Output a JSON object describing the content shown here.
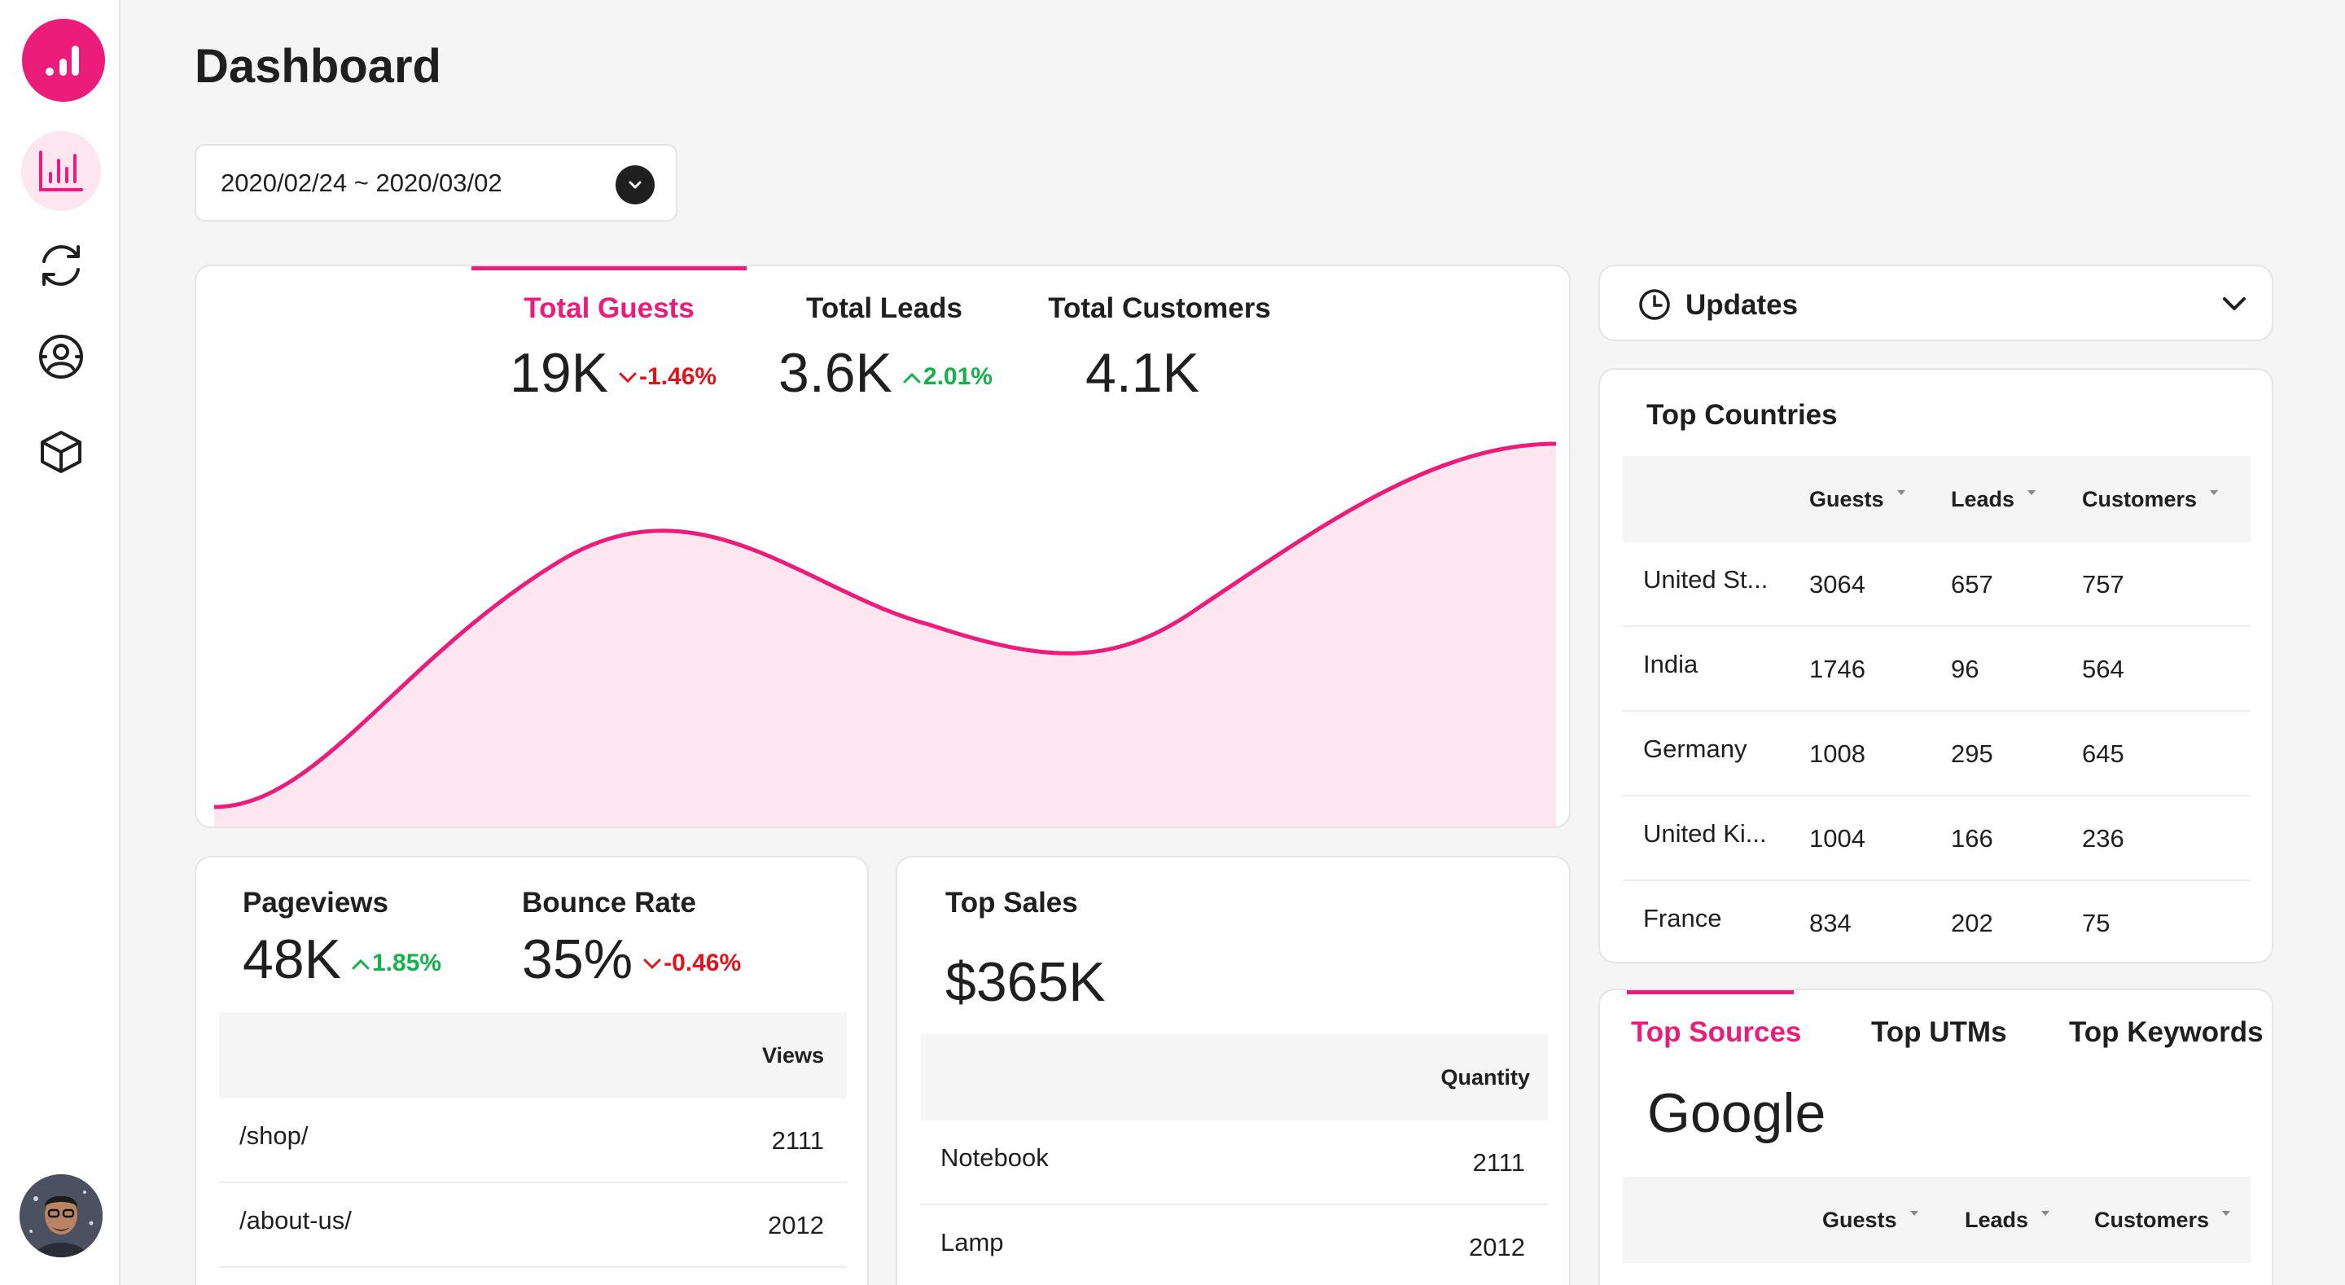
{
  "page_title": "Dashboard",
  "date_range": "2020/02/24 ~ 2020/03/02",
  "sidebar": {
    "items": [
      {
        "name": "analytics-icon",
        "active": true
      },
      {
        "name": "sync-icon",
        "active": false
      },
      {
        "name": "contacts-icon",
        "active": false
      },
      {
        "name": "package-icon",
        "active": false
      }
    ]
  },
  "colors": {
    "accent": "#ec1c7b",
    "accent_light": "#fde6f0",
    "up": "#13b24a",
    "down": "#e0141b"
  },
  "overview": {
    "tabs": [
      {
        "label": "Total Guests",
        "value": "19K",
        "delta": "-1.46%",
        "direction": "down",
        "active": true
      },
      {
        "label": "Total Leads",
        "value": "3.6K",
        "delta": "2.01%",
        "direction": "up",
        "active": false
      },
      {
        "label": "Total Customers",
        "value": "4.1K",
        "delta": "",
        "direction": "",
        "active": false
      }
    ]
  },
  "updates": {
    "label": "Updates"
  },
  "top_countries": {
    "title": "Top Countries",
    "columns": [
      "Guests",
      "Leads",
      "Customers"
    ],
    "rows": [
      {
        "country": "United St...",
        "guests": "3064",
        "leads": "657",
        "customers": "757"
      },
      {
        "country": "India",
        "guests": "1746",
        "leads": "96",
        "customers": "564"
      },
      {
        "country": "Germany",
        "guests": "1008",
        "leads": "295",
        "customers": "645"
      },
      {
        "country": "United Ki...",
        "guests": "1004",
        "leads": "166",
        "customers": "236"
      },
      {
        "country": "France",
        "guests": "834",
        "leads": "202",
        "customers": "75"
      }
    ]
  },
  "pageviews": {
    "metrics": [
      {
        "label": "Pageviews",
        "value": "48K",
        "delta": "1.85%",
        "direction": "up"
      },
      {
        "label": "Bounce Rate",
        "value": "35%",
        "delta": "-0.46%",
        "direction": "down"
      }
    ],
    "column": "Views",
    "rows": [
      {
        "path": "/shop/",
        "views": "2111"
      },
      {
        "path": "/about-us/",
        "views": "2012"
      }
    ]
  },
  "top_sales": {
    "title": "Top Sales",
    "value": "$365K",
    "column": "Quantity",
    "rows": [
      {
        "item": "Notebook",
        "quantity": "2111"
      },
      {
        "item": "Lamp",
        "quantity": "2012"
      }
    ]
  },
  "sources": {
    "tabs": [
      {
        "label": "Top Sources",
        "active": true
      },
      {
        "label": "Top UTMs",
        "active": false
      },
      {
        "label": "Top Keywords",
        "active": false
      }
    ],
    "headline": "Google",
    "columns": [
      "Guests",
      "Leads",
      "Customers"
    ]
  }
}
